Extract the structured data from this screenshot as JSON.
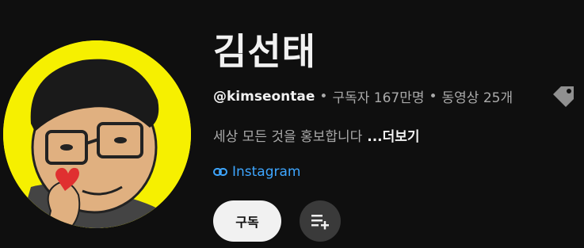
{
  "channel": {
    "name": "김선태",
    "handle": "@kimseontae",
    "subscribers": "구독자 167만명",
    "videos": "동영상 25개",
    "separator": "•",
    "description": "세상 모든 것을 홍보합니다",
    "more_label": "...더보기",
    "link_label": "Instagram"
  },
  "actions": {
    "subscribe_label": "구독"
  },
  "icons": {
    "tag": "tag-icon",
    "link": "link-icon",
    "playlist_add": "playlist-add-icon"
  },
  "colors": {
    "background": "#0f0f0f",
    "link": "#3ea6ff",
    "avatar_background": "#f6f000"
  }
}
